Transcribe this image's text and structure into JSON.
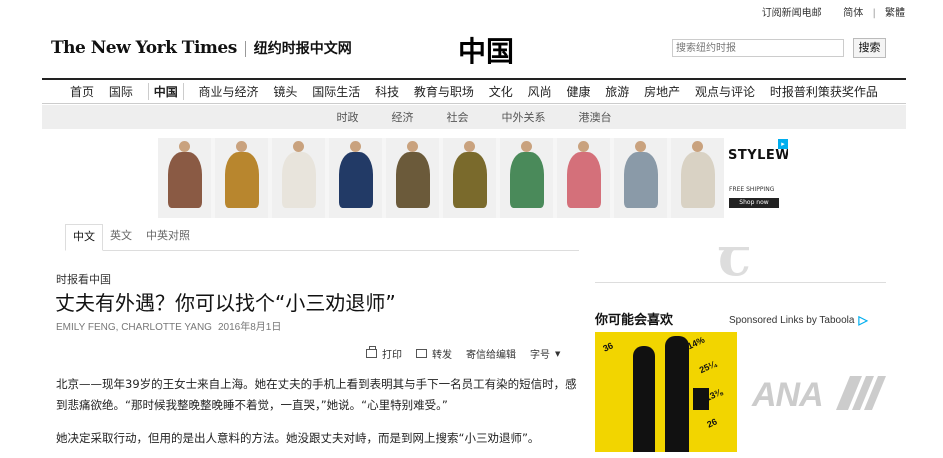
{
  "topbar": {
    "subscribe": "订阅新闻电邮",
    "simplified": "简体",
    "traditional": "繁體"
  },
  "masthead": {
    "logo_en": "The New York Times",
    "logo_cn": "纽约时报中文网",
    "section_title": "中国",
    "search_placeholder": "搜索纽约时报",
    "search_button": "搜索"
  },
  "nav": {
    "items": [
      "首页",
      "国际",
      "中国",
      "商业与经济",
      "镜头",
      "国际生活",
      "科技",
      "教育与职场",
      "文化",
      "风尚",
      "健康",
      "旅游",
      "房地产",
      "观点与评论",
      "时报普利策获奖作品"
    ],
    "active": "中国"
  },
  "subnav": {
    "items": [
      "时政",
      "经济",
      "社会",
      "中外关系",
      "港澳台"
    ]
  },
  "ad": {
    "brand": "STYLEWE",
    "shipping": "FREE SHIPPING",
    "cta": "Shop now",
    "colors": [
      "#8a5a44",
      "#b8862e",
      "#e8e4dc",
      "#223a66",
      "#6b5a3a",
      "#7a6a2c",
      "#4a8a5a",
      "#d4707a",
      "#8a9aa8",
      "#d9d2c4",
      "#2a6a8a"
    ]
  },
  "lang_tabs": {
    "items": [
      "中文",
      "英文",
      "中英对照"
    ],
    "active": "中文"
  },
  "article": {
    "kicker": "时报看中国",
    "headline": "丈夫有外遇？你可以找个“小三劝退师”",
    "authors": "EMILY FENG, CHARLOTTE YANG",
    "date": "2016年8月1日",
    "tools": {
      "print": "打印",
      "share": "转发",
      "letter": "寄信给编辑",
      "font_size": "字号"
    },
    "paragraphs": [
      "北京——现年39岁的王女士来自上海。她在丈夫的手机上看到表明其与手下一名员工有染的短信时，感到悲痛欲绝。“那时候我整晚整晚睡不着觉，一直哭，”她说。“心里特别难受。”",
      "她决定采取行动，但用的是出人意料的方法。她没跟丈夫对峙，而是到网上搜索“小三劝退师”。"
    ]
  },
  "sidebar": {
    "recommend_title": "你可能会喜欢",
    "sponsored": "Sponsored Links by Taboola",
    "ana_text": "ANA"
  }
}
